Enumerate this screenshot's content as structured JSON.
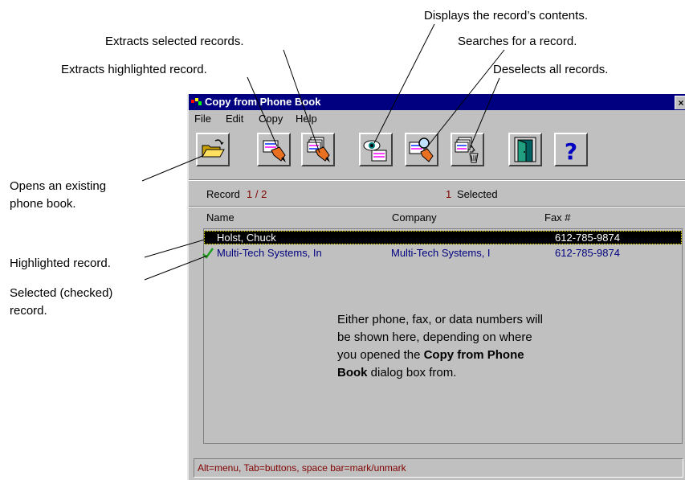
{
  "callouts": {
    "displays": "Displays the record’s contents.",
    "extracts_selected": "Extracts selected records.",
    "searches": "Searches for a record.",
    "extracts_highlighted": "Extracts highlighted record.",
    "deselects": "Deselects all records.",
    "opens_line1": "Opens an existing",
    "opens_line2": "phone book.",
    "highlighted_record": "Highlighted record.",
    "selected_line1": "Selected (checked)",
    "selected_line2": "record."
  },
  "window": {
    "title": "Copy from Phone Book",
    "close": "×"
  },
  "menu": {
    "file": "File",
    "edit": "Edit",
    "copy": "Copy",
    "help": "Help"
  },
  "toolbar": {
    "help_glyph": "?"
  },
  "status": {
    "record_label": "Record",
    "record_value": "1 / 2",
    "selected_count": "1",
    "selected_label": "Selected"
  },
  "columns": {
    "name": "Name",
    "company": "Company",
    "fax": "Fax #"
  },
  "rows": [
    {
      "name": "Holst, Chuck",
      "company": "",
      "fax": "612-785-9874"
    },
    {
      "name": "Multi-Tech Systems, In",
      "company": "Multi-Tech Systems, I",
      "fax": "612-785-9874"
    }
  ],
  "note": {
    "part1": "Either phone, fax, or data numbers will be shown here, depending on where you opened the ",
    "bold1": "Copy from Phone Book",
    "part2": " dialog box from."
  },
  "statusbar": {
    "text": "Alt=menu, Tab=buttons, space bar=mark/unmark"
  },
  "colors": {
    "titlebar": "#000080",
    "window_bg": "#c0c0c0",
    "status_red": "#800000",
    "selected_blue": "#000080",
    "check_green": "#20a020"
  }
}
